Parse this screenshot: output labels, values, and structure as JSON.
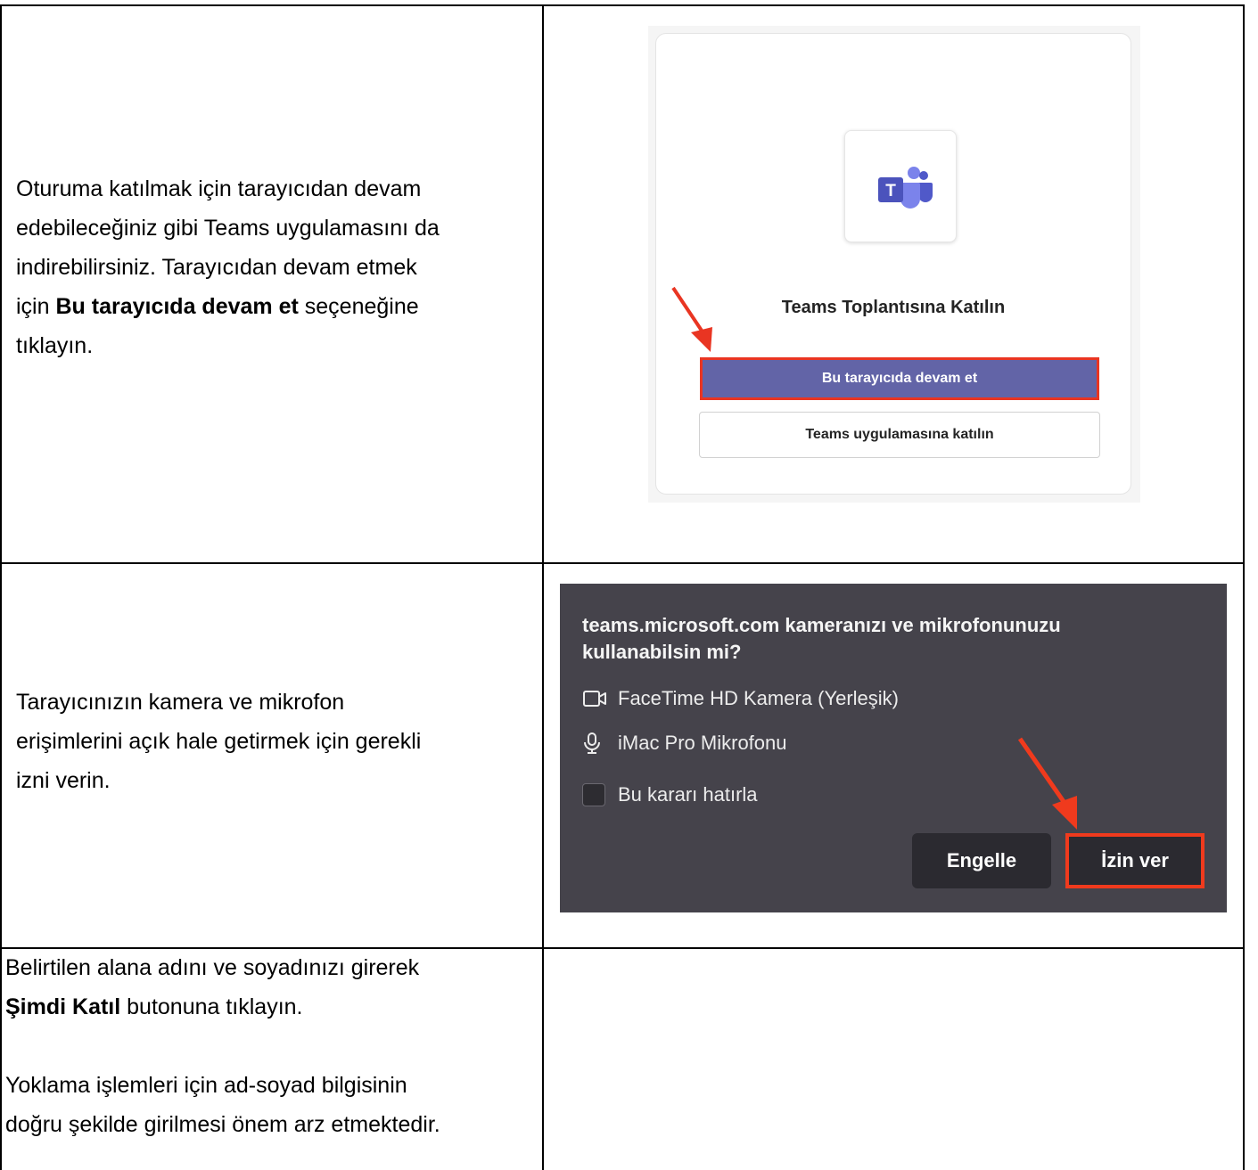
{
  "rows": [
    {
      "text_line1": "Oturuma katılmak için tarayıcıdan devam",
      "text_line2": "edebileceğiniz gibi Teams uygulamasını da",
      "text_line3": "indirebilirsiniz. Tarayıcıdan devam etmek",
      "text_line4_pre": "için ",
      "text_line4_bold": "Bu tarayıcıda devam et",
      "text_line4_post": " seçeneğine",
      "text_line5": "tıklayın."
    },
    {
      "text_line1": "Tarayıcınızın kamera ve mikrofon",
      "text_line2": "erişimlerini açık hale getirmek için gerekli",
      "text_line3": "izni verin."
    },
    {
      "text_line1": "Belirtilen alana adını ve soyadınızı girerek",
      "text_line2_bold": "Şimdi Katıl",
      "text_line2_post": " butonuna tıklayın.",
      "text_line3": "Yoklama işlemleri için ad-soyad bilgisinin",
      "text_line4": "doğru şekilde girilmesi önem arz etmektedir."
    }
  ],
  "teams_card": {
    "title": "Teams Toplantısına Katılın",
    "browser_button": "Bu tarayıcıda devam et",
    "app_button": "Teams uygulamasına katılın",
    "logo_icon": "teams-logo-icon",
    "brand_color": "#6264a7",
    "highlight_color": "#e93522"
  },
  "permission_dialog": {
    "title_line1": "teams.microsoft.com kameranızı ve mikrofonunuzu",
    "title_line2": "kullanabilsin mi?",
    "camera_label": "FaceTime HD Kamera (Yerleşik)",
    "mic_label": "iMac Pro Mikrofonu",
    "remember_label": "Bu kararı hatırla",
    "block_button": "Engelle",
    "allow_button": "İzin ver",
    "background_color": "#45434b",
    "highlight_color": "#f03a1d"
  }
}
